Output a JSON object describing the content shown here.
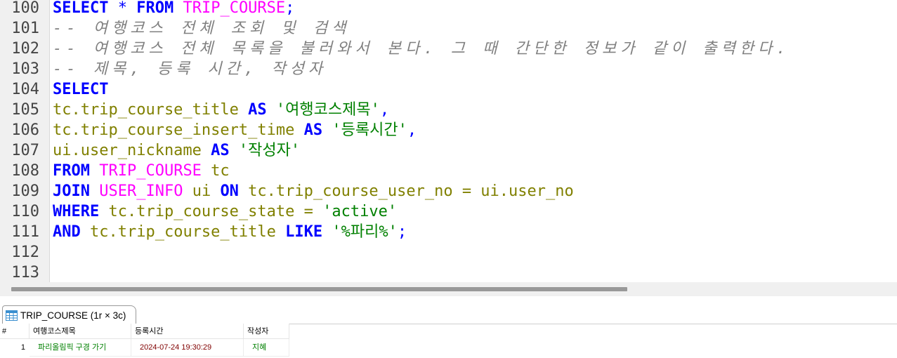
{
  "editor": {
    "lines": [
      {
        "num": "100",
        "tokens": [
          {
            "t": "SELECT",
            "c": "kw"
          },
          {
            "t": " ",
            "c": "id"
          },
          {
            "t": "*",
            "c": "punct"
          },
          {
            "t": " ",
            "c": "id"
          },
          {
            "t": "FROM",
            "c": "kw"
          },
          {
            "t": " ",
            "c": "id"
          },
          {
            "t": "TRIP_COURSE",
            "c": "tbl"
          },
          {
            "t": ";",
            "c": "punct"
          }
        ]
      },
      {
        "num": "101",
        "tokens": [
          {
            "t": "-- 여행코스 전체 조회 및 검색",
            "c": "cm"
          }
        ]
      },
      {
        "num": "102",
        "tokens": [
          {
            "t": "-- 여행코스 전체 목록을 불러와서 본다. 그 때 간단한 정보가 같이 출력한다.",
            "c": "cm"
          }
        ]
      },
      {
        "num": "103",
        "tokens": [
          {
            "t": "-- 제목, 등록 시간, 작성자",
            "c": "cm"
          }
        ]
      },
      {
        "num": "104",
        "tokens": [
          {
            "t": "SELECT",
            "c": "kw"
          }
        ]
      },
      {
        "num": "105",
        "tokens": [
          {
            "t": "tc.trip_course_title ",
            "c": "id"
          },
          {
            "t": "AS",
            "c": "kw"
          },
          {
            "t": " ",
            "c": "id"
          },
          {
            "t": "'여행코스제목'",
            "c": "str"
          },
          {
            "t": ",",
            "c": "punct"
          }
        ]
      },
      {
        "num": "106",
        "tokens": [
          {
            "t": "tc.trip_course_insert_time ",
            "c": "id"
          },
          {
            "t": "AS",
            "c": "kw"
          },
          {
            "t": " ",
            "c": "id"
          },
          {
            "t": "'등록시간'",
            "c": "str"
          },
          {
            "t": ",",
            "c": "punct"
          }
        ]
      },
      {
        "num": "107",
        "tokens": [
          {
            "t": "ui.user_nickname ",
            "c": "id"
          },
          {
            "t": "AS",
            "c": "kw"
          },
          {
            "t": " ",
            "c": "id"
          },
          {
            "t": "'작성자'",
            "c": "str"
          }
        ]
      },
      {
        "num": "108",
        "tokens": [
          {
            "t": "FROM",
            "c": "kw"
          },
          {
            "t": " ",
            "c": "id"
          },
          {
            "t": "TRIP_COURSE",
            "c": "tbl"
          },
          {
            "t": " tc",
            "c": "id"
          }
        ]
      },
      {
        "num": "109",
        "tokens": [
          {
            "t": "JOIN",
            "c": "kw"
          },
          {
            "t": " ",
            "c": "id"
          },
          {
            "t": "USER_INFO",
            "c": "tbl"
          },
          {
            "t": " ui ",
            "c": "id"
          },
          {
            "t": "ON",
            "c": "kw"
          },
          {
            "t": " tc.trip_course_user_no = ui.user_no",
            "c": "id"
          }
        ]
      },
      {
        "num": "110",
        "tokens": [
          {
            "t": "WHERE",
            "c": "kw"
          },
          {
            "t": " tc.trip_course_state = ",
            "c": "id"
          },
          {
            "t": "'active'",
            "c": "str"
          }
        ]
      },
      {
        "num": "111",
        "tokens": [
          {
            "t": "AND",
            "c": "kw"
          },
          {
            "t": " tc.trip_course_title ",
            "c": "id"
          },
          {
            "t": "LIKE",
            "c": "kw"
          },
          {
            "t": " ",
            "c": "id"
          },
          {
            "t": "'%파리%'",
            "c": "str"
          },
          {
            "t": ";",
            "c": "punct"
          }
        ]
      },
      {
        "num": "112",
        "tokens": []
      },
      {
        "num": "113",
        "tokens": []
      }
    ]
  },
  "results": {
    "tab_label": "TRIP_COURSE (1r × 3c)",
    "columns": [
      "#",
      "여행코스제목",
      "등록시간",
      "작성자"
    ],
    "rows": [
      {
        "num": "1",
        "title": "파리올림픽 구경 가기",
        "time": "2024-07-24 19:30:29",
        "author": "지혜"
      }
    ]
  },
  "colors": {
    "keyword": "#0000ff",
    "table": "#ff00ff",
    "identifier": "#808000",
    "string": "#008000",
    "comment": "#808080"
  }
}
